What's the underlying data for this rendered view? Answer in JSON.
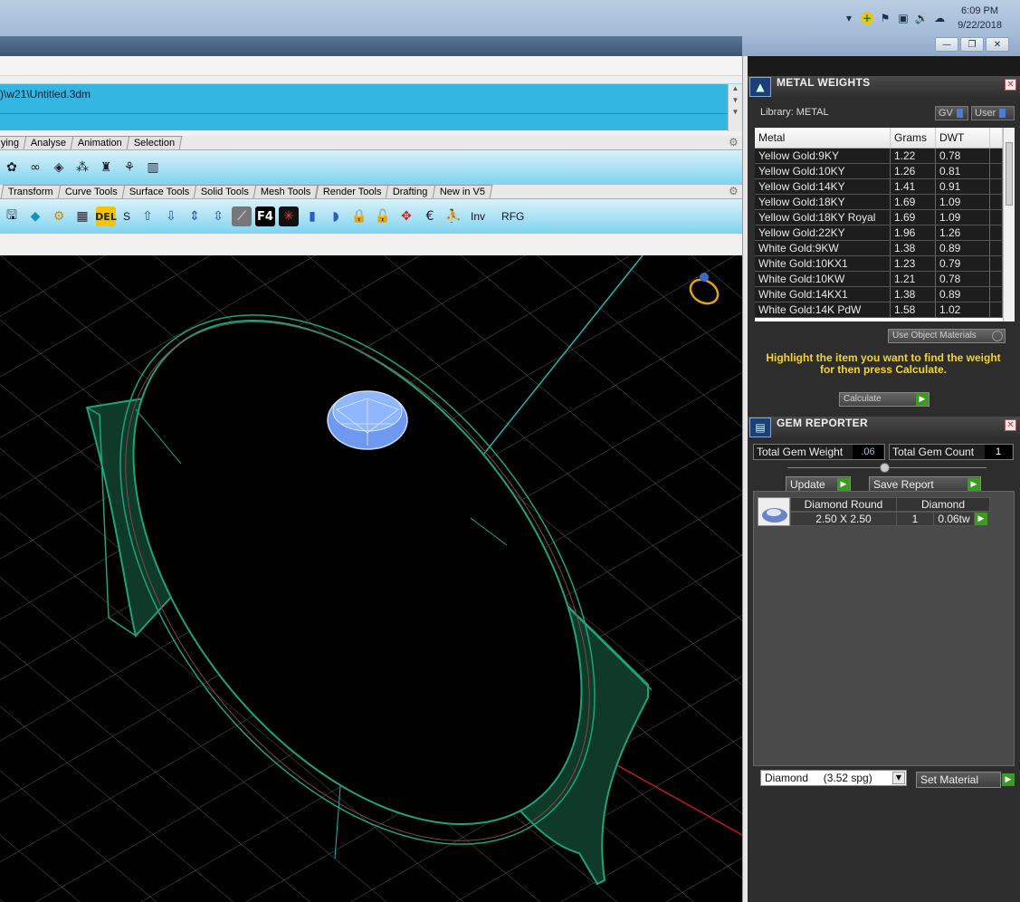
{
  "tray": {
    "time": "6:09 PM",
    "date": "9/22/2018",
    "icons": [
      "chevron-up-icon",
      "plus-badge-icon",
      "flag-icon",
      "network-icon",
      "speaker-icon",
      "cloud-upload-icon"
    ]
  },
  "window_controls": {
    "minimize": "—",
    "restore": "❐",
    "close": "✕"
  },
  "command": {
    "path": ")\\w21\\Untitled.3dm"
  },
  "tabs_row1": [
    "ying",
    "Analyse",
    "Animation",
    "Selection"
  ],
  "tabs_row2": [
    "Transform",
    "Curve Tools",
    "Surface Tools",
    "Solid Tools",
    "Mesh Tools",
    "Render Tools",
    "Drafting",
    "New in V5"
  ],
  "toolbar2": {
    "s_label": "S",
    "inv_label": "Inv",
    "rfg_label": "RFG"
  },
  "metal_weights": {
    "title": "METAL WEIGHTS",
    "library_label": "Library: METAL",
    "gv_label": "GV",
    "user_label": "User",
    "columns": [
      "Metal",
      "Grams",
      "DWT"
    ],
    "rows": [
      [
        "Yellow Gold:9KY",
        "1.22",
        "0.78"
      ],
      [
        "Yellow Gold:10KY",
        "1.26",
        "0.81"
      ],
      [
        "Yellow Gold:14KY",
        "1.41",
        "0.91"
      ],
      [
        "Yellow Gold:18KY",
        "1.69",
        "1.09"
      ],
      [
        "Yellow Gold:18KY Royal",
        "1.69",
        "1.09"
      ],
      [
        "Yellow Gold:22KY",
        "1.96",
        "1.26"
      ],
      [
        "White Gold:9KW",
        "1.38",
        "0.89"
      ],
      [
        "White Gold:10KX1",
        "1.23",
        "0.79"
      ],
      [
        "White Gold:10KW",
        "1.21",
        "0.78"
      ],
      [
        "White Gold:14KX1",
        "1.38",
        "0.89"
      ],
      [
        "White Gold:14K PdW",
        "1.58",
        "1.02"
      ]
    ],
    "use_object_materials": "Use Object Materials",
    "hint": "Highlight the item you want to find the weight for then press Calculate.",
    "calculate": "Calculate"
  },
  "gem_reporter": {
    "title": "GEM REPORTER",
    "total_weight_label": "Total Gem Weight",
    "total_weight": ".06",
    "total_count_label": "Total Gem Count",
    "total_count": "1",
    "update": "Update",
    "save_report": "Save Report",
    "gem": {
      "name": "Diamond Round",
      "size": "2.50 X 2.50",
      "material": "Diamond",
      "qty": "1",
      "weight": "0.06tw"
    },
    "material_select": "Diamond     (3.52 spg)",
    "set_material": "Set Material"
  },
  "colors": {
    "ring": "#0e3d2c",
    "ring_edge": "#1c9a75",
    "gem": "#8fb7ff",
    "accent_blue": "#33b6e2"
  }
}
